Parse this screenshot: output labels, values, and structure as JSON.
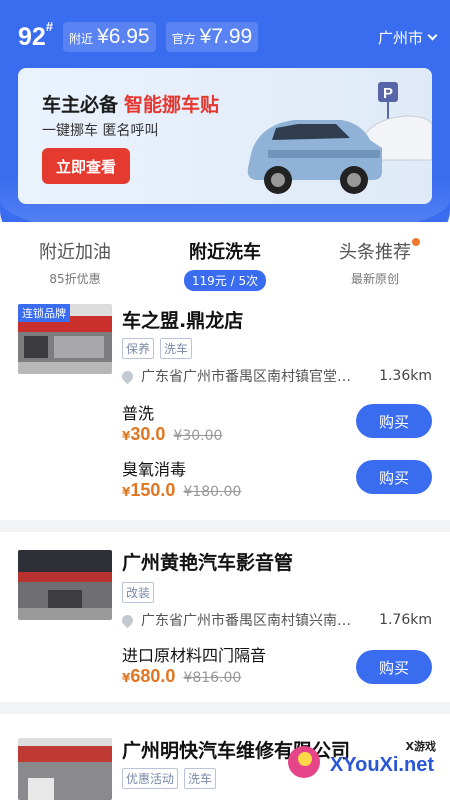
{
  "header": {
    "oil_type": "92",
    "oil_superscript": "#",
    "nearby_label": "附近",
    "nearby_price": "¥6.95",
    "official_label": "官方",
    "official_price": "¥7.99",
    "city": "广州市"
  },
  "banner": {
    "title_part1": "车主必备",
    "title_part2": "智能挪车贴",
    "subtitle": "一键挪车  匿名呼叫",
    "button": "立即查看",
    "parking_sign": "P"
  },
  "tabs": [
    {
      "label": "附近加油",
      "sub": "85折优惠"
    },
    {
      "label": "附近洗车",
      "sub": "119元 / 5次"
    },
    {
      "label": "头条推荐",
      "sub": "最新原创"
    }
  ],
  "shops": [
    {
      "badge": "连锁品牌",
      "name": "车之盟.鼎龙店",
      "tags": [
        "保养",
        "洗车"
      ],
      "address": "广东省广州市番禺区南村镇官堂…",
      "distance": "1.36km",
      "services": [
        {
          "name": "普洗",
          "currency": "¥",
          "price": "30.0",
          "old_price": "¥30.00",
          "buy": "购买"
        },
        {
          "name": "臭氧消毒",
          "currency": "¥",
          "price": "150.0",
          "old_price": "¥180.00",
          "buy": "购买"
        }
      ]
    },
    {
      "name": "广州黄艳汽车影音管",
      "tags": [
        "改装"
      ],
      "address": "广东省广州市番禺区南村镇兴南…",
      "distance": "1.76km",
      "services": [
        {
          "name": "进口原材料四门隔音",
          "currency": "¥",
          "price": "680.0",
          "old_price": "¥816.00",
          "buy": "购买"
        }
      ]
    },
    {
      "name": "广州明快汽车维修有限公司",
      "tags": [
        "优惠活动",
        "洗车"
      ]
    }
  ],
  "watermark": {
    "top": "X游戏",
    "text": "XYouXi.net"
  },
  "colors": {
    "primary": "#3a6cf0",
    "accent_red": "#e53a2f",
    "price_orange": "#e27620"
  }
}
